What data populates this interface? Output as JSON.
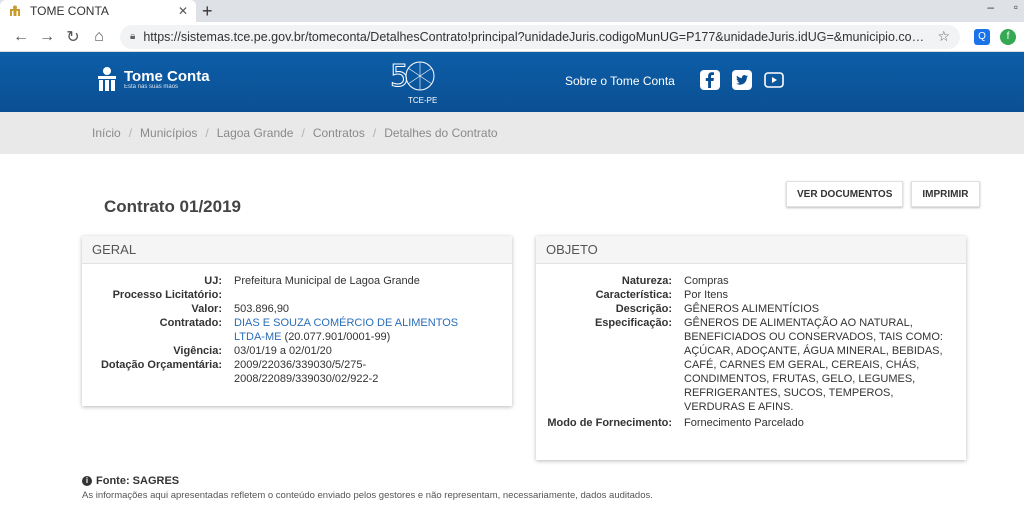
{
  "browser": {
    "tab_title": "TOME CONTA",
    "url": "https://sistemas.tce.pe.gov.br/tomeconta/DetalhesContrato!principal?unidadeJuris.codigoMunUG=P177&unidadeJuris.idUG=&municipio.codigo=P177&municipio.n..."
  },
  "header": {
    "brand_name": "Tome Conta",
    "brand_tagline": "Está nas suas mãos",
    "emblem_text": "TCE-PE",
    "about_link": "Sobre o Tome Conta"
  },
  "breadcrumb": [
    "Início",
    "Municípios",
    "Lagoa Grande",
    "Contratos",
    "Detalhes do Contrato"
  ],
  "page": {
    "title": "Contrato 01/2019",
    "btn_documents": "VER DOCUMENTOS",
    "btn_print": "IMPRIMIR"
  },
  "geral": {
    "heading": "GERAL",
    "rows": [
      {
        "label": "UJ:",
        "value": "Prefeitura Municipal de Lagoa Grande"
      },
      {
        "label": "Processo Licitatório:",
        "value": ""
      },
      {
        "label": "Valor:",
        "value": "503.896,90"
      },
      {
        "label": "Contratado:",
        "link": "DIAS E SOUZA COMÉRCIO DE ALIMENTOS LTDA-ME",
        "value": "(20.077.901/0001-99)"
      },
      {
        "label": "Vigência:",
        "value": "03/01/19 a 02/01/20"
      },
      {
        "label": "Dotação Orçamentária:",
        "value": "2009/22036/339030/5/275-2008/22089/339030/02/922-2"
      }
    ]
  },
  "objeto": {
    "heading": "OBJETO",
    "rows": [
      {
        "label": "Natureza:",
        "value": "Compras"
      },
      {
        "label": "Característica:",
        "value": "Por Itens"
      },
      {
        "label": "Descrição:",
        "value": "GÊNEROS ALIMENTÍCIOS"
      },
      {
        "label": "Especificação:",
        "value": "GÊNEROS DE ALIMENTAÇÃO AO NATURAL, BENEFICIADOS OU CONSERVADOS, TAIS COMO: AÇÚCAR, ADOÇANTE, ÁGUA MINERAL, BEBIDAS, CAFÉ, CARNES EM GERAL, CEREAIS, CHÁS, CONDIMENTOS, FRUTAS, GELO, LEGUMES, REFRIGERANTES, SUCOS, TEMPEROS, VERDURAS E AFINS."
      },
      {
        "label": "Modo de Fornecimento:",
        "value": "Fornecimento Parcelado"
      }
    ]
  },
  "footer": {
    "source": "Fonte: SAGRES",
    "note": "As informações aqui apresentadas refletem o conteúdo enviado pelos gestores e não representam, necessariamente, dados auditados."
  },
  "colors": {
    "header_blue": "#0b4f93",
    "link_blue": "#2a6db8",
    "breadcrumb_bg": "#e9e9e9"
  }
}
